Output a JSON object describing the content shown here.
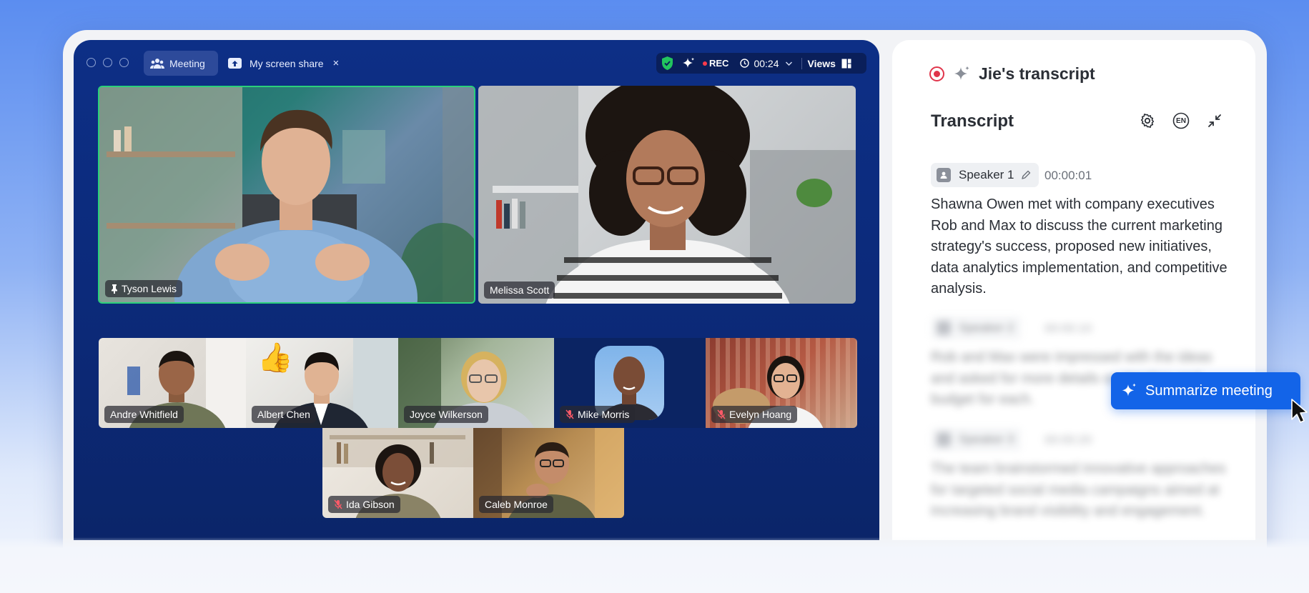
{
  "tabs": {
    "meeting_label": "Meeting",
    "screen_share_label": "My screen share",
    "close_symbol": "×"
  },
  "status": {
    "rec_label": "REC",
    "timer": "00:24",
    "views_label": "Views"
  },
  "participants": {
    "main": [
      {
        "name": "Tyson Lewis",
        "pinned": true,
        "active_speaker": true,
        "muted": false
      },
      {
        "name": "Melissa Scott",
        "pinned": false,
        "active_speaker": false,
        "muted": false
      }
    ],
    "grid": [
      {
        "name": "Andre Whitfield",
        "muted": false
      },
      {
        "name": "Albert Chen",
        "muted": false,
        "reaction": "👍"
      },
      {
        "name": "Joyce Wilkerson",
        "muted": false
      },
      {
        "name": "Mike Morris",
        "muted": true
      },
      {
        "name": "Evelyn Hoang",
        "muted": true
      },
      {
        "name": "Ida Gibson",
        "muted": true
      },
      {
        "name": "Caleb Monroe",
        "muted": false
      }
    ]
  },
  "transcript_panel": {
    "header_title": "Jie's transcript",
    "section_title": "Transcript",
    "language_badge": "EN",
    "entries": [
      {
        "speaker": "Speaker 1",
        "time": "00:00:01",
        "text": "Shawna Owen met with company executives Rob and Max to discuss the current marketing strategy's success, proposed new initiatives, data analytics implementation, and competitive analysis."
      },
      {
        "speaker": "Speaker 2",
        "time": "00:00:10",
        "text": "Rob and Max were impressed with the ideas and asked for more details on timeline and budget for each."
      },
      {
        "speaker": "Speaker 3",
        "time": "00:00:20",
        "text": "The team brainstormed innovative approaches for targeted social media campaigns aimed at increasing brand visibility and engagement."
      }
    ]
  },
  "summarize_button": {
    "label": "Summarize meeting"
  },
  "colors": {
    "accent": "#1364e8",
    "meeting_bg": "#0d2f86",
    "rec_red": "#e0344a",
    "active_speaker_border": "#2bd07a",
    "shield_green": "#22c55e"
  },
  "icons": [
    "participants-icon",
    "screen-share-icon",
    "shield-icon",
    "sparkle-icon",
    "clock-icon",
    "chevron-down-icon",
    "views-layout-icon",
    "pin-icon",
    "mic-muted-icon",
    "record-icon",
    "gear-icon",
    "language-icon",
    "collapse-icon",
    "speaker-avatar-icon",
    "pencil-icon",
    "cursor-icon"
  ]
}
